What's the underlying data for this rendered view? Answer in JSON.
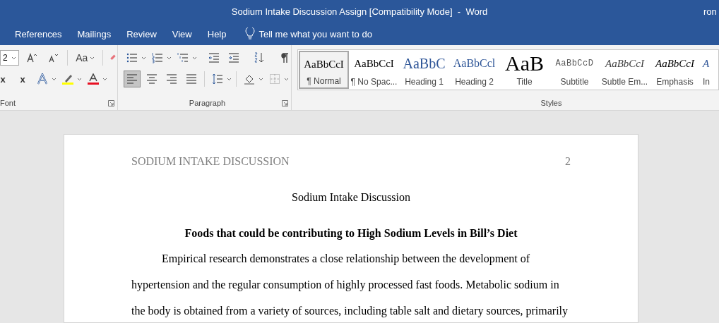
{
  "window": {
    "title": "Sodium Intake Discussion Assign [Compatibility Mode]  -  Word",
    "user": "ron"
  },
  "tabs": [
    {
      "label": "References",
      "selected": false
    },
    {
      "label": "Mailings",
      "selected": false
    },
    {
      "label": "Review",
      "selected": false
    },
    {
      "label": "View",
      "selected": false
    },
    {
      "label": "Help",
      "selected": false
    }
  ],
  "tell_me": {
    "placeholder": "Tell me what you want to do"
  },
  "ribbon": {
    "font": {
      "label": "Font",
      "size": "2",
      "case_button": "Aa",
      "row_1": [
        {
          "kind": "grow",
          "dropdown": false
        },
        {
          "kind": "shrink",
          "dropdown": false
        }
      ],
      "row_2": [
        {
          "kind": "subscript",
          "label": "x"
        },
        {
          "kind": "superscript",
          "label": "x"
        },
        {
          "kind": "effects",
          "dropdown": true
        },
        {
          "kind": "highlight",
          "dropdown": true,
          "color": "#ffff00"
        },
        {
          "kind": "fontcolor",
          "dropdown": true,
          "color": "#e81123"
        }
      ]
    },
    "paragraph": {
      "label": "Paragraph",
      "row_1": [
        {
          "kind": "bullets",
          "selected": false,
          "dropdown": true
        },
        {
          "kind": "numbering",
          "selected": false,
          "dropdown": true
        },
        {
          "kind": "multilevel",
          "selected": false,
          "dropdown": true
        },
        {
          "kind": "sep"
        },
        {
          "kind": "outdent",
          "selected": false,
          "dropdown": false
        },
        {
          "kind": "indent",
          "selected": false,
          "dropdown": false
        },
        {
          "kind": "sep"
        },
        {
          "kind": "sort",
          "selected": false,
          "dropdown": false
        },
        {
          "kind": "sep"
        },
        {
          "kind": "pilcrow",
          "selected": false,
          "dropdown": false
        }
      ],
      "row_2": [
        {
          "kind": "left",
          "selected": true,
          "dropdown": false
        },
        {
          "kind": "center",
          "selected": false,
          "dropdown": false
        },
        {
          "kind": "right",
          "selected": false,
          "dropdown": false
        },
        {
          "kind": "justify",
          "selected": false,
          "dropdown": false
        },
        {
          "kind": "sep"
        },
        {
          "kind": "spacing",
          "selected": false,
          "dropdown": true
        },
        {
          "kind": "sep"
        },
        {
          "kind": "shading",
          "selected": false,
          "dropdown": true
        },
        {
          "kind": "borders",
          "selected": false,
          "dropdown": true
        }
      ]
    },
    "styles": {
      "label": "Styles",
      "items": [
        {
          "preview": "AaBbCcI",
          "name": "¶ Normal",
          "kind": "normal",
          "selected": true
        },
        {
          "preview": "AaBbCcI",
          "name": "¶ No Spac...",
          "kind": "normal",
          "selected": false
        },
        {
          "preview": "AaBbC",
          "name": "Heading 1",
          "kind": "heading1",
          "selected": false
        },
        {
          "preview": "AaBbCcl",
          "name": "Heading 2",
          "kind": "heading2",
          "selected": false
        },
        {
          "preview": "AaB",
          "name": "Title",
          "kind": "title",
          "selected": false
        },
        {
          "preview": "AaBbCcD",
          "name": "Subtitle",
          "kind": "subtitle",
          "selected": false
        },
        {
          "preview": "AaBbCcI",
          "name": "Subtle Em...",
          "kind": "subtle",
          "selected": false
        },
        {
          "preview": "AaBbCcI",
          "name": "Emphasis",
          "kind": "emphasis",
          "selected": false
        },
        {
          "preview": "A",
          "name": "In",
          "kind": "intense",
          "selected": false
        }
      ]
    }
  },
  "document": {
    "header": "SODIUM INTAKE DISCUSSION",
    "page_number": "2",
    "title": "Sodium Intake Discussion",
    "heading": "Foods that could be contributing to High Sodium Levels in Bill’s Diet",
    "paragraphs": [
      "Empirical research demonstrates a close relationship between the development of hypertension and the regular consumption of highly processed fast foods. Metabolic sodium in the body is obtained from a variety of sources, including table salt and dietary sources, primarily"
    ]
  }
}
